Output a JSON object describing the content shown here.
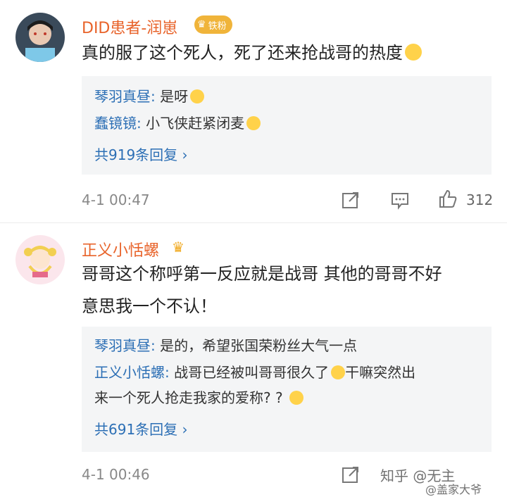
{
  "comments": [
    {
      "username": "DID患者-润崽",
      "badge": "铁粉",
      "text": "真的服了这个死人，死了还来抢战哥的热度",
      "replies": [
        {
          "author": "琴羽真昼:",
          "text": " 是呀"
        },
        {
          "author": "蠢镜镜:",
          "text": " 小飞侠赶紧闭麦"
        }
      ],
      "more_replies": "共919条回复 ›",
      "time": "4-1 00:47",
      "likes": "312"
    },
    {
      "username": "正义小恬螺",
      "text_line1": "哥哥这个称呼第一反应就是战哥 其他的哥哥不好",
      "text_line2": "意思我一个不认！",
      "replies": [
        {
          "author": "琴羽真昼:",
          "text": " 是的，希望张国荣粉丝大气一点"
        },
        {
          "author": "正义小恬螺:",
          "text": " 战哥已经被叫哥哥很久了",
          "text2": "干嘛突然出"
        },
        {
          "text_cont": "来一个死人抢走我家的爱称? ? "
        }
      ],
      "more_replies": "共691条回复 ›",
      "time": "4-1 00:46"
    }
  ],
  "watermark": {
    "zhihu": "知乎 @无主",
    "weibo": "@盖家大爷"
  },
  "colors": {
    "username": "#e8632a",
    "reply_author": "#2c6fb5",
    "reply_bg": "#f4f5f6",
    "meta": "#888888"
  },
  "icons": [
    "share-icon",
    "comment-icon",
    "like-icon",
    "crown-icon"
  ]
}
